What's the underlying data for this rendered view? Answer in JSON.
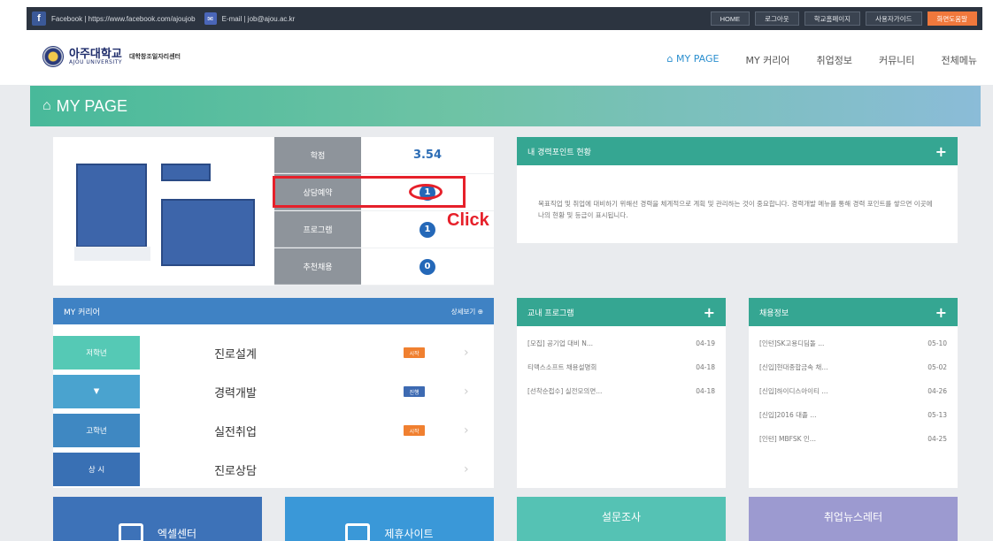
{
  "topbar": {
    "facebook_icon": "f",
    "facebook_text": "Facebook | https://www.facebook.com/ajoujob",
    "mail_icon": "✉",
    "email_text": "E-mail | job@ajou.ac.kr",
    "buttons": [
      "HOME",
      "로그아웃",
      "학교홈페이지",
      "사용자가이드",
      "화면도움말"
    ],
    "accent_color": "#f0783c"
  },
  "header": {
    "logo_kr": "아주대학교",
    "logo_en": "AJOU UNIVERSITY",
    "logo_sub": "대학창조일자리센터",
    "nav": [
      {
        "label": "MY PAGE",
        "icon": "home-icon",
        "active": true
      },
      {
        "label": "MY 커리어"
      },
      {
        "label": "취업정보"
      },
      {
        "label": "커뮤니티"
      },
      {
        "label": "전체메뉴"
      }
    ]
  },
  "banner": {
    "title": "MY PAGE",
    "icon": "home-icon"
  },
  "profile": {
    "stats": [
      {
        "label": "학점",
        "value": "3.54",
        "kind": "text"
      },
      {
        "label": "상담예약",
        "value": "1",
        "kind": "circle"
      },
      {
        "label": "프로그램",
        "value": "1",
        "kind": "circle"
      },
      {
        "label": "추천채용",
        "value": "0",
        "kind": "circle"
      }
    ],
    "highlight_label": "Click",
    "highlight_color": "#e6202a"
  },
  "career_points": {
    "title": "내 경력포인트 현황",
    "plus": "+",
    "description": "목표직업 및 취업에 대비하기 위해선 경력을 체계적으로 계획 및 관리하는 것이 중요합니다. 경력개발 메뉴를 통해 경력 포인트를 쌓으면 이곳에 나의 현황 및 등급이 표시됩니다."
  },
  "my_career": {
    "title": "MY 커리어",
    "more": "상세보기 ⊕",
    "rows": [
      {
        "side": "저학년",
        "title": "진로설계",
        "badge": "시작",
        "side_color": "#55c9b5",
        "badge_color": "#f08030"
      },
      {
        "side": "▼",
        "title": "경력개발",
        "badge": "진행",
        "side_color": "#4aa3cf",
        "badge_color": "#3d6ab2"
      },
      {
        "side": "고학년",
        "title": "실전취업",
        "badge": "시작",
        "side_color": "#3f88c2",
        "badge_color": "#f08030"
      },
      {
        "side": "상 시",
        "title": "진로상담",
        "badge": "",
        "side_color": "#3970b4",
        "badge_color": "#ffffff"
      }
    ]
  },
  "programs": {
    "title": "교내 프로그램",
    "plus": "+",
    "items": [
      {
        "text": "[모집] 공기업 대비 N...",
        "date": "04-19"
      },
      {
        "text": "티맥스소프트 채용설명회",
        "date": "04-18"
      },
      {
        "text": "[선착순접수] 실전모의면...",
        "date": "04-18"
      }
    ]
  },
  "jobs": {
    "title": "채용정보",
    "plus": "+",
    "items": [
      {
        "text": "[인턴]SK고용디딤돌 ...",
        "date": "05-10"
      },
      {
        "text": "[신입]현대종합금속 채...",
        "date": "05-02"
      },
      {
        "text": "[신입]하이디스아이티 ...",
        "date": "04-26"
      },
      {
        "text": "[신입]2016 대졸 ...",
        "date": "05-13"
      },
      {
        "text": "[인턴] MBFSK 인...",
        "date": "04-25"
      }
    ]
  },
  "tiles": [
    {
      "label": "엑셀센터",
      "color": "#3d72b8"
    },
    {
      "label": "제휴사이트",
      "color": "#3a98d8"
    },
    {
      "label": "설문조사",
      "color": "#55c2b4"
    },
    {
      "label": "취업뉴스레터",
      "color": "#9c9ad0"
    }
  ]
}
